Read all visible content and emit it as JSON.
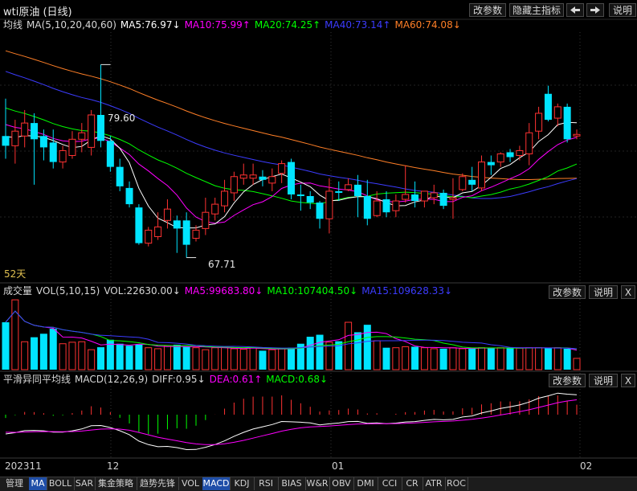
{
  "header": {
    "title": "wti原油 (日线)",
    "buttons": {
      "edit_params": "改参数",
      "hide_indicator": "隐藏主指标",
      "prev_icon": "arrow-left-icon",
      "next_icon": "arrow-right-icon",
      "help": "说明"
    }
  },
  "ma_line": {
    "name": "均线",
    "params": "MA(5,10,20,40,60)",
    "ma5": "MA5:76.97↓",
    "ma10": "MA10:75.99↑",
    "ma20": "MA20:74.25↑",
    "ma40": "MA40:73.14↑",
    "ma60": "MA60:74.08↓",
    "high_label": "79.60",
    "low_label": "67.71",
    "days_label": "52天"
  },
  "vol_line": {
    "name": "成交量",
    "params": "VOL(5,10,15)",
    "vol": "VOL:22630.00↓",
    "ma5": "MA5:99683.80↓",
    "ma10": "MA10:107404.50↓",
    "ma15": "MA15:109628.33↓",
    "edit_params": "改参数",
    "help": "说明",
    "close": "X"
  },
  "macd_line": {
    "name": "平滑异同平均线",
    "params": "MACD(12,26,9)",
    "diff": "DIFF:0.95↓",
    "dea": "DEA:0.61↑",
    "macd": "MACD:0.68↓",
    "edit_params": "改参数",
    "help": "说明",
    "close": "X"
  },
  "date_axis": {
    "start": "202311",
    "dec": "12",
    "jan": "01",
    "feb": "02"
  },
  "tabs": [
    "管理",
    "MA",
    "BOLL",
    "SAR",
    "集金策略",
    "趋势先锋",
    "VOL",
    "MACD",
    "KDJ",
    "RSI",
    "BIAS",
    "W&R",
    "OBV",
    "DMI",
    "CCI",
    "CR",
    "ATR",
    "ROC"
  ],
  "active_tabs": [
    "MA",
    "MACD"
  ],
  "colors": {
    "up": "#ff3232",
    "down": "#00e4ff",
    "ma5": "#ffffff",
    "ma10": "#ff00ff",
    "ma20": "#00ff00",
    "ma40": "#3c3cff",
    "ma60": "#ff7f27",
    "text": "#c8c8c8"
  },
  "chart_data": {
    "type": "candlestick",
    "instrument": "wti原油",
    "candles": [
      {
        "o": 75.2,
        "h": 77.5,
        "l": 73.8,
        "c": 74.6
      },
      {
        "o": 74.6,
        "h": 76.2,
        "l": 73.5,
        "c": 75.5
      },
      {
        "o": 75.2,
        "h": 76.8,
        "l": 74.5,
        "c": 76.0
      },
      {
        "o": 76.0,
        "h": 76.6,
        "l": 72.2,
        "c": 75.0
      },
      {
        "o": 75.2,
        "h": 75.6,
        "l": 73.7,
        "c": 74.5
      },
      {
        "o": 74.8,
        "h": 75.6,
        "l": 73.2,
        "c": 73.6
      },
      {
        "o": 73.6,
        "h": 74.6,
        "l": 73.2,
        "c": 74.3
      },
      {
        "o": 74.0,
        "h": 75.5,
        "l": 73.8,
        "c": 75.0
      },
      {
        "o": 75.0,
        "h": 76.0,
        "l": 74.2,
        "c": 75.4
      },
      {
        "o": 74.5,
        "h": 76.8,
        "l": 74.0,
        "c": 76.5
      },
      {
        "o": 76.5,
        "h": 79.6,
        "l": 74.5,
        "c": 74.9
      },
      {
        "o": 74.9,
        "h": 75.2,
        "l": 73.0,
        "c": 73.3
      },
      {
        "o": 73.3,
        "h": 73.8,
        "l": 71.8,
        "c": 72.1
      },
      {
        "o": 72.0,
        "h": 72.4,
        "l": 70.8,
        "c": 71.0
      },
      {
        "o": 70.8,
        "h": 71.0,
        "l": 68.5,
        "c": 68.6
      },
      {
        "o": 68.6,
        "h": 69.6,
        "l": 68.4,
        "c": 69.4
      },
      {
        "o": 69.0,
        "h": 70.5,
        "l": 68.8,
        "c": 69.6
      },
      {
        "o": 70.0,
        "h": 71.3,
        "l": 69.5,
        "c": 70.7
      },
      {
        "o": 70.0,
        "h": 70.3,
        "l": 68.0,
        "c": 69.5
      },
      {
        "o": 70.0,
        "h": 70.5,
        "l": 67.71,
        "c": 68.5
      },
      {
        "o": 68.9,
        "h": 69.7,
        "l": 68.7,
        "c": 69.4
      },
      {
        "o": 69.5,
        "h": 71.4,
        "l": 69.1,
        "c": 70.5
      },
      {
        "o": 70.4,
        "h": 71.4,
        "l": 70.0,
        "c": 71.0
      },
      {
        "o": 70.9,
        "h": 72.5,
        "l": 70.5,
        "c": 71.8
      },
      {
        "o": 71.7,
        "h": 73.0,
        "l": 71.2,
        "c": 72.7
      },
      {
        "o": 72.6,
        "h": 73.5,
        "l": 72.2,
        "c": 72.8
      },
      {
        "o": 72.6,
        "h": 73.5,
        "l": 72.2,
        "c": 72.8
      },
      {
        "o": 72.7,
        "h": 73.1,
        "l": 72.1,
        "c": 72.5
      },
      {
        "o": 72.3,
        "h": 73.2,
        "l": 71.8,
        "c": 72.7
      },
      {
        "o": 72.9,
        "h": 73.7,
        "l": 72.3,
        "c": 73.5
      },
      {
        "o": 73.6,
        "h": 73.8,
        "l": 71.3,
        "c": 71.6
      },
      {
        "o": 71.6,
        "h": 72.2,
        "l": 70.6,
        "c": 71.5
      },
      {
        "o": 71.5,
        "h": 71.8,
        "l": 70.7,
        "c": 71.1
      },
      {
        "o": 71.1,
        "h": 71.2,
        "l": 69.5,
        "c": 70.1
      },
      {
        "o": 70.1,
        "h": 72.6,
        "l": 69.2,
        "c": 71.8
      },
      {
        "o": 71.8,
        "h": 72.4,
        "l": 71.2,
        "c": 71.7
      },
      {
        "o": 71.9,
        "h": 72.6,
        "l": 71.8,
        "c": 72.2
      },
      {
        "o": 72.2,
        "h": 72.8,
        "l": 70.2,
        "c": 71.5
      },
      {
        "o": 71.5,
        "h": 72.5,
        "l": 69.7,
        "c": 70.1
      },
      {
        "o": 70.3,
        "h": 71.8,
        "l": 70.2,
        "c": 71.2
      },
      {
        "o": 71.3,
        "h": 71.8,
        "l": 70.2,
        "c": 70.5
      },
      {
        "o": 70.6,
        "h": 71.6,
        "l": 70.2,
        "c": 71.2
      },
      {
        "o": 71.3,
        "h": 73.4,
        "l": 71.1,
        "c": 71.6
      },
      {
        "o": 71.6,
        "h": 72.4,
        "l": 70.8,
        "c": 71.2
      },
      {
        "o": 71.2,
        "h": 71.8,
        "l": 70.8,
        "c": 71.8
      },
      {
        "o": 71.4,
        "h": 72.2,
        "l": 71.0,
        "c": 71.7
      },
      {
        "o": 71.7,
        "h": 71.9,
        "l": 70.7,
        "c": 70.9
      },
      {
        "o": 71.3,
        "h": 72.6,
        "l": 70.1,
        "c": 71.4
      },
      {
        "o": 71.9,
        "h": 72.9,
        "l": 71.8,
        "c": 72.7
      },
      {
        "o": 72.5,
        "h": 73.3,
        "l": 71.8,
        "c": 72.2
      },
      {
        "o": 72.0,
        "h": 74.0,
        "l": 71.8,
        "c": 73.6
      },
      {
        "o": 73.6,
        "h": 74.0,
        "l": 72.8,
        "c": 73.4
      },
      {
        "o": 73.6,
        "h": 74.2,
        "l": 73.3,
        "c": 74.1
      },
      {
        "o": 74.2,
        "h": 74.4,
        "l": 73.6,
        "c": 73.9
      },
      {
        "o": 74.0,
        "h": 74.6,
        "l": 73.7,
        "c": 74.3
      },
      {
        "o": 74.1,
        "h": 76.0,
        "l": 73.4,
        "c": 75.4
      },
      {
        "o": 75.5,
        "h": 77.0,
        "l": 75.0,
        "c": 76.6
      },
      {
        "o": 77.8,
        "h": 78.3,
        "l": 76.1,
        "c": 76.2
      },
      {
        "o": 76.3,
        "h": 77.2,
        "l": 75.8,
        "c": 77.0
      },
      {
        "o": 77.0,
        "h": 77.2,
        "l": 74.8,
        "c": 75.0
      },
      {
        "o": 75.2,
        "h": 75.6,
        "l": 75.0,
        "c": 75.3
      }
    ],
    "ma_values": {
      "MA5": 76.97,
      "MA10": 75.99,
      "MA20": 74.25,
      "MA40": 73.14,
      "MA60": 74.08
    },
    "price_high": 79.6,
    "price_low": 67.71,
    "volume": [
      95000,
      140000,
      56000,
      65000,
      72000,
      82000,
      52000,
      55000,
      56000,
      40000,
      45000,
      60000,
      52000,
      48000,
      50000,
      44000,
      42000,
      48000,
      50000,
      46000,
      44000,
      40000,
      44000,
      45000,
      42000,
      41000,
      45000,
      38000,
      40000,
      42000,
      44000,
      52000,
      66000,
      70000,
      55000,
      57000,
      95000,
      75000,
      90000,
      58000,
      44000,
      44000,
      46000,
      46000,
      44000,
      42000,
      42000,
      44000,
      42000,
      43000,
      44000,
      44000,
      44000,
      44000,
      43000,
      44000,
      44000,
      43000,
      44000,
      42000,
      22630
    ],
    "macd": {
      "diff": 0.95,
      "dea": 0.61,
      "macd": 0.68
    },
    "x_labels": [
      "202311",
      "12",
      "01",
      "02"
    ]
  }
}
